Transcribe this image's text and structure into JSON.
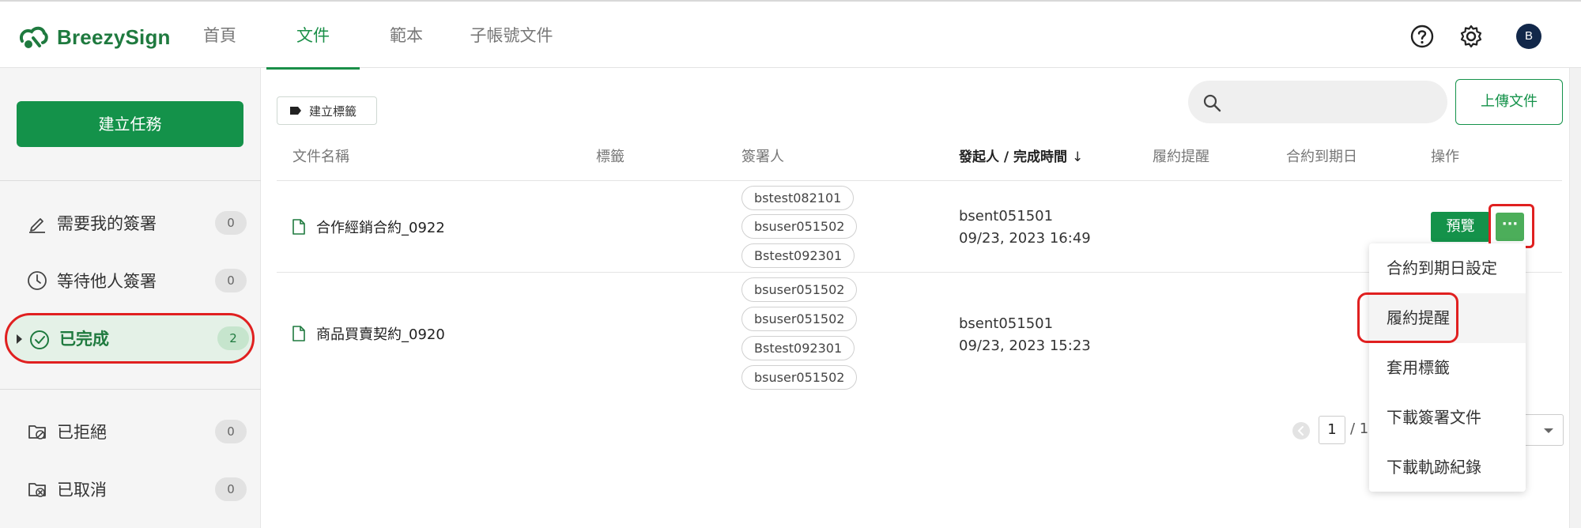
{
  "app": {
    "brand": "BreezySign"
  },
  "nav": {
    "tabs": [
      "首頁",
      "文件",
      "範本",
      "子帳號文件"
    ],
    "active": "文件"
  },
  "topbar": {
    "avatar_initial": "B"
  },
  "sidebar": {
    "create_label": "建立任務",
    "items": [
      {
        "label": "需要我的簽署",
        "count": "0",
        "icon": "pen-icon"
      },
      {
        "label": "等待他人簽署",
        "count": "0",
        "icon": "clock-icon"
      },
      {
        "label": "已完成",
        "count": "2",
        "icon": "check-circle-icon"
      },
      {
        "label": "已拒絕",
        "count": "0",
        "icon": "folder-reject-icon"
      },
      {
        "label": "已取消",
        "count": "0",
        "icon": "folder-cancel-icon"
      }
    ],
    "active": "已完成"
  },
  "toolbar": {
    "tag_label": "建立標籤",
    "search_placeholder": "",
    "upload_label": "上傳文件"
  },
  "table": {
    "headers": [
      "文件名稱",
      "標籤",
      "簽署人",
      "發起人 / 完成時間",
      "履約提醒",
      "合約到期日",
      "操作"
    ],
    "rows": [
      {
        "name": "合作經銷合約_0922",
        "signers": [
          "bstest082101",
          "bsuser051502",
          "Bstest092301"
        ],
        "sender": "bsent051501",
        "time": "09/23, 2023 16:49",
        "action": "預覽"
      },
      {
        "name": "商品買賣契約_0920",
        "signers": [
          "bsuser051502",
          "bsuser051502",
          "Bstest092301",
          "bsuser051502"
        ],
        "sender": "bsent051501",
        "time": "09/23, 2023 15:23"
      }
    ]
  },
  "menu": {
    "items": [
      "合約到期日設定",
      "履約提醒",
      "套用標籤",
      "下載簽署文件",
      "下載軌跡紀錄"
    ],
    "highlighted": "履約提醒"
  },
  "pagination": {
    "current": "1",
    "total": "/ 1"
  },
  "colors": {
    "primary": "#14924a",
    "highlight": "#e02020"
  }
}
